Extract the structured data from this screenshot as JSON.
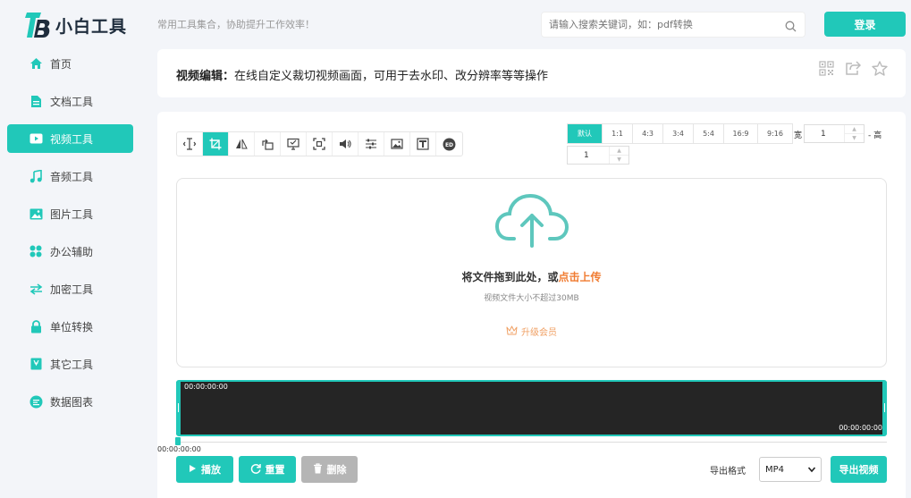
{
  "header": {
    "logo_text": "小白工具",
    "slogan": "常用工具集合，协助提升工作效率！",
    "search_placeholder": "请输入搜索关键词，如：pdf转换",
    "login_label": "登录"
  },
  "sidebar": {
    "items": [
      {
        "label": "首页",
        "icon": "home-icon"
      },
      {
        "label": "文档工具",
        "icon": "document-icon"
      },
      {
        "label": "视频工具",
        "icon": "video-icon",
        "active": true
      },
      {
        "label": "音频工具",
        "icon": "music-icon"
      },
      {
        "label": "图片工具",
        "icon": "image-icon"
      },
      {
        "label": "办公辅助",
        "icon": "grid-icon"
      },
      {
        "label": "加密工具",
        "icon": "swap-icon"
      },
      {
        "label": "单位转换",
        "icon": "lock-icon"
      },
      {
        "label": "其它工具",
        "icon": "bookmark-icon"
      },
      {
        "label": "数据图表",
        "icon": "chart-icon"
      }
    ]
  },
  "title_panel": {
    "title_bold": "视频编辑：",
    "title_rest": "在线自定义裁切视频画面，可用于去水印、改分辨率等等操作"
  },
  "editor": {
    "ratios": [
      "默认",
      "1:1",
      "4:3",
      "3:4",
      "5:4",
      "16:9",
      "9:16"
    ],
    "width_label": "宽",
    "height_label": "- 高",
    "width_value": "1",
    "height_value": "1",
    "drop_text": "将文件拖到此处，或",
    "drop_link": "点击上传",
    "drop_hint": "视频文件大小不超过30MB",
    "vip_label": "升级会员",
    "timeline_start": "00:00:00:00",
    "timeline_end": "00:00:00:00",
    "scrub_time": "00:00:00:00",
    "play_label": "播放",
    "reset_label": "重置",
    "delete_label": "删除",
    "export_format_label": "导出格式",
    "export_format_value": "MP4",
    "export_button_label": "导出视频"
  },
  "colors": {
    "accent": "#21c8b9",
    "link": "#f07c32",
    "vip": "#f0a064"
  }
}
